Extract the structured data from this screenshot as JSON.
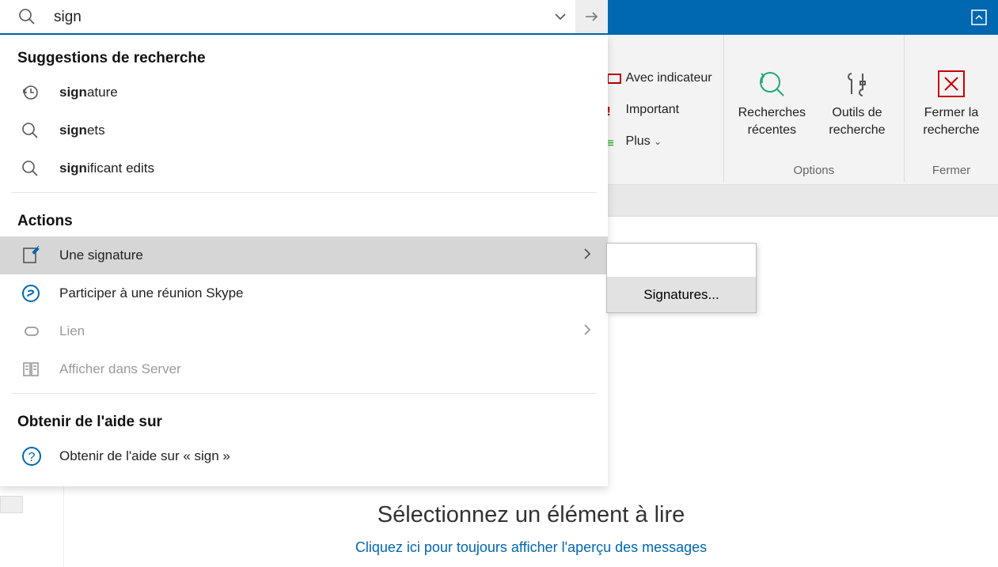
{
  "search": {
    "value": "sign",
    "placeholder": ""
  },
  "suggestions_header": "Suggestions de recherche",
  "suggestions": [
    {
      "kind": "history",
      "bold": "sign",
      "rest": "ature"
    },
    {
      "kind": "search",
      "bold": "sign",
      "rest": "ets"
    },
    {
      "kind": "search",
      "bold": "sign",
      "rest": "ificant edits"
    }
  ],
  "actions_header": "Actions",
  "actions": [
    {
      "icon": "signature-icon",
      "label": "Une signature",
      "has_sub": true,
      "selected": true,
      "disabled": false
    },
    {
      "icon": "skype-icon",
      "label": "Participer à une réunion Skype",
      "has_sub": false,
      "selected": false,
      "disabled": false
    },
    {
      "icon": "link-icon",
      "label": "Lien",
      "has_sub": true,
      "selected": false,
      "disabled": true
    },
    {
      "icon": "server-icon",
      "label": "Afficher dans Server",
      "has_sub": false,
      "selected": false,
      "disabled": true
    }
  ],
  "help_header": "Obtenir de l'aide sur",
  "help_item": "Obtenir de l'aide sur « sign »",
  "flyout": {
    "item": "Signatures..."
  },
  "ribbon": {
    "mini": {
      "avec": "Avec indicateur",
      "imp": "Important",
      "plus": "Plus"
    },
    "recherches_l1": "Recherches",
    "recherches_l2": "récentes",
    "outils_l1": "Outils de",
    "outils_l2": "recherche",
    "fermer_l1": "Fermer la",
    "fermer_l2": "recherche",
    "group_options": "Options",
    "group_fermer": "Fermer"
  },
  "content": {
    "title": "Sélectionnez un élément à lire",
    "link": "Cliquez ici pour toujours afficher l'aperçu des messages"
  }
}
